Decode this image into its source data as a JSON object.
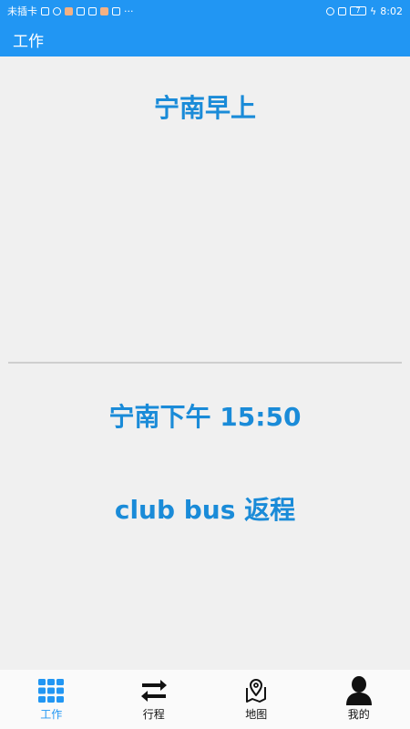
{
  "status_bar": {
    "carrier": "未插卡",
    "time": "8:02",
    "battery": "7"
  },
  "app_bar": {
    "title": "工作"
  },
  "main": {
    "morning_title": "宁南早上",
    "afternoon_title": "宁南下午 15:50",
    "return_title": "club bus 返程"
  },
  "bottom_nav": {
    "items": [
      {
        "label": "工作",
        "icon": "grid-icon",
        "active": true
      },
      {
        "label": "行程",
        "icon": "swap-arrows-icon",
        "active": false
      },
      {
        "label": "地图",
        "icon": "map-pin-icon",
        "active": false
      },
      {
        "label": "我的",
        "icon": "person-icon",
        "active": false
      }
    ]
  },
  "colors": {
    "primary": "#2196f3",
    "title_text": "#1a8bd8",
    "background": "#f0f0f0"
  }
}
